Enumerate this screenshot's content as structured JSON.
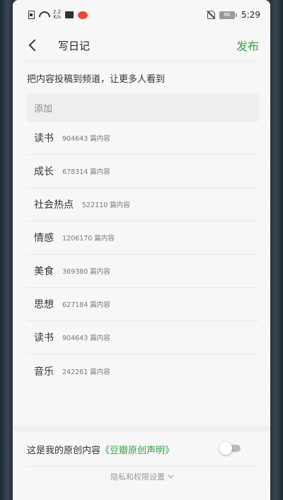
{
  "status_bar": {
    "speed_top": "2.2",
    "speed_bottom": "K/s",
    "battery": "86",
    "time": "5:29"
  },
  "header": {
    "title": "写日记",
    "publish_label": "发布"
  },
  "subtitle": "把内容投稿到频道，让更多人看到",
  "add_placeholder": "添加",
  "channels": [
    {
      "name": "读书",
      "count": "904643 篇内容"
    },
    {
      "name": "成长",
      "count": "678314 篇内容"
    },
    {
      "name": "社会热点",
      "count": "522110 篇内容"
    },
    {
      "name": "情感",
      "count": "1206170 篇内容"
    },
    {
      "name": "美食",
      "count": "369380 篇内容"
    },
    {
      "name": "思想",
      "count": "627184 篇内容"
    },
    {
      "name": "读书",
      "count": "904643 篇内容"
    },
    {
      "name": "音乐",
      "count": "242261 篇内容"
    }
  ],
  "original": {
    "label": "这是我的原创内容",
    "link": "《豆瓣原创声明》",
    "toggle_on": false
  },
  "privacy_label": "隐私和权限设置",
  "colors": {
    "accent": "#2fa14a"
  }
}
